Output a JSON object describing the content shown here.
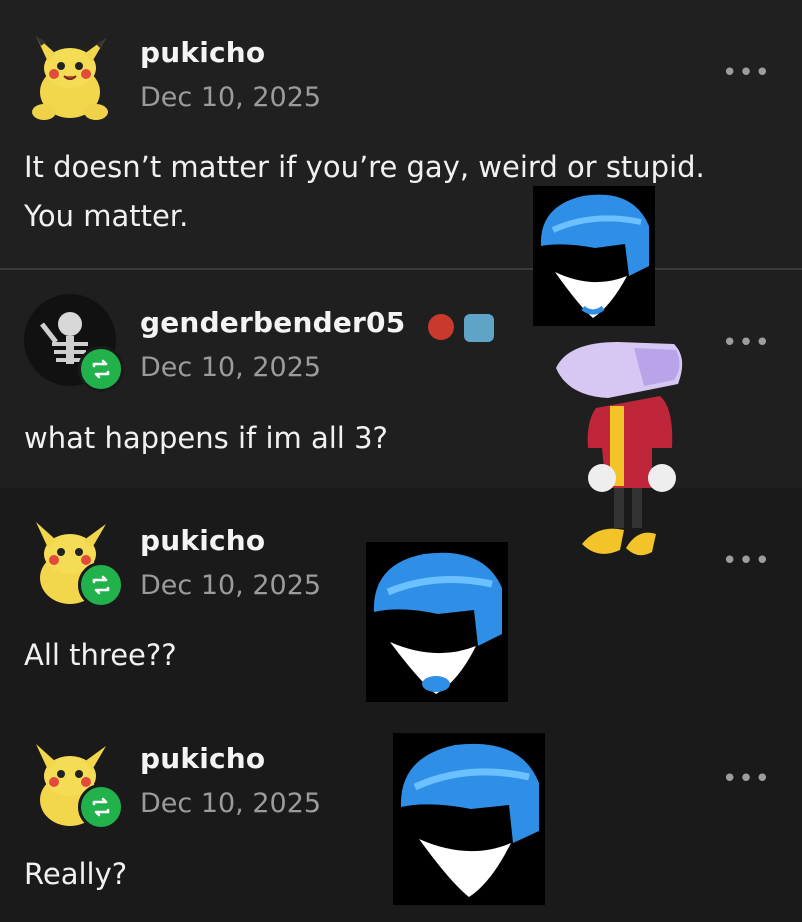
{
  "posts": [
    {
      "username": "pukicho",
      "date": "Dec 10, 2025",
      "text_lines": [
        "It doesn’t matter if you’re gay, weird or stupid.",
        "You matter."
      ]
    },
    {
      "username": "genderbender05",
      "date": "Dec 10, 2025",
      "text_lines": [
        "what happens if im all 3?"
      ]
    },
    {
      "username": "pukicho",
      "date": "Dec 10, 2025",
      "text_lines": [
        "All three??"
      ]
    },
    {
      "username": "pukicho",
      "date": "Dec 10, 2025",
      "text_lines": [
        "Really?"
      ]
    }
  ],
  "more_label": "•••",
  "icons": {
    "avatar_pukicho": "pikachu-plush-avatar",
    "avatar_genderbender": "skeleton-avatar",
    "reblog": "reblog-icon",
    "more": "more-options-icon",
    "badge1": "red-badge-icon",
    "badge2": "blue-badge-icon"
  },
  "colors": {
    "background": "#1a1a1a",
    "reblog_green": "#22b24c",
    "text": "#f1f1f1",
    "muted": "#9b9b9b"
  }
}
